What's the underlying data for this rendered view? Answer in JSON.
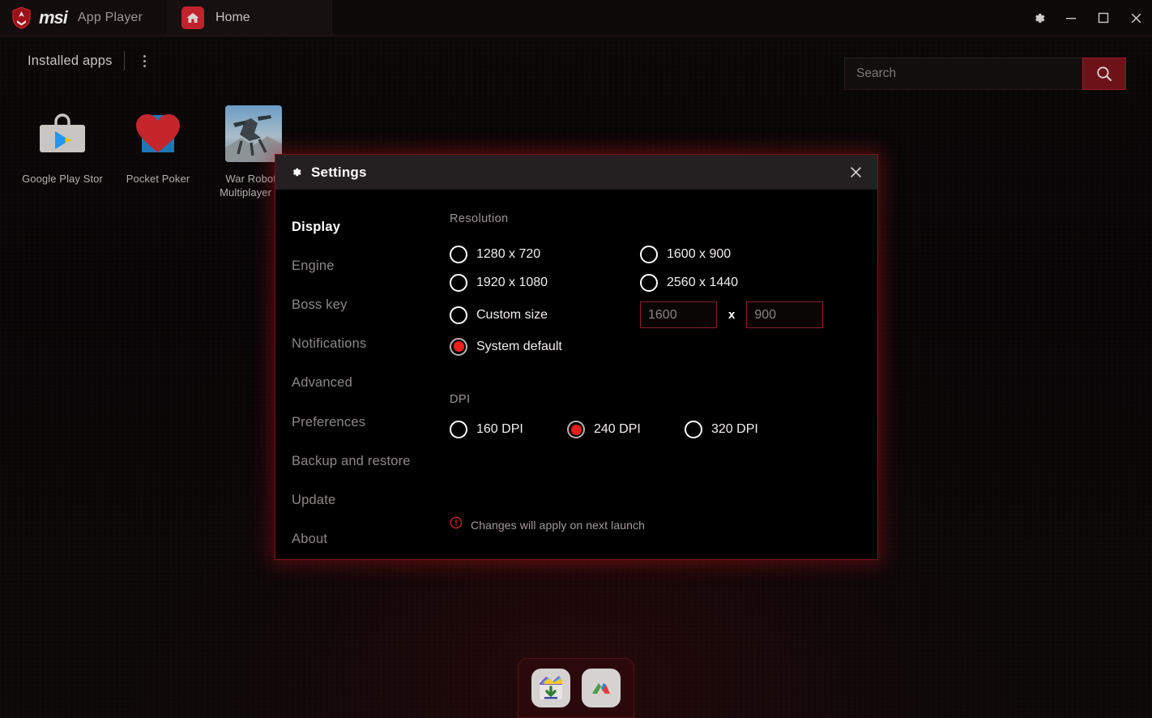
{
  "titlebar": {
    "brand_word": "msi",
    "brand_suffix": "App Player",
    "tab_label": "Home",
    "tab_icon": "home-icon",
    "settings_icon": "gear-icon",
    "minimize_icon": "minimize-icon",
    "maximize_icon": "maximize-icon",
    "close_icon": "close-icon"
  },
  "content": {
    "installed_label": "Installed apps",
    "kebab_icon": "more-options-icon"
  },
  "search": {
    "value": "",
    "placeholder": "Search",
    "icon": "search-icon"
  },
  "apps": [
    {
      "name": "Google Play Stor",
      "icon": "google-play-icon"
    },
    {
      "name": "Pocket Poker",
      "icon": "pocket-poker-icon"
    },
    {
      "name": "War Robots Multiplayer Ba",
      "icon": "war-robots-icon"
    }
  ],
  "dock": {
    "items": [
      {
        "icon": "media-gallery-icon"
      },
      {
        "icon": "app-center-icon"
      }
    ]
  },
  "dialog": {
    "title": "Settings",
    "gear_icon": "gear-icon",
    "close_icon": "close-icon",
    "nav": [
      {
        "label": "Display",
        "active": true
      },
      {
        "label": "Engine",
        "active": false
      },
      {
        "label": "Boss key",
        "active": false
      },
      {
        "label": "Notifications",
        "active": false
      },
      {
        "label": "Advanced",
        "active": false
      },
      {
        "label": "Preferences",
        "active": false
      },
      {
        "label": "Backup and restore",
        "active": false
      },
      {
        "label": "Update",
        "active": false
      },
      {
        "label": "About",
        "active": false
      }
    ],
    "resolution": {
      "section_label": "Resolution",
      "options": [
        {
          "label": "1280 x 720",
          "checked": false
        },
        {
          "label": "1600 x 900",
          "checked": false
        },
        {
          "label": "1920 x 1080",
          "checked": false
        },
        {
          "label": "2560 x 1440",
          "checked": false
        },
        {
          "label": "Custom size",
          "checked": false
        },
        {
          "label": "System default",
          "checked": true
        }
      ],
      "custom_width": {
        "value": "",
        "placeholder": "1600"
      },
      "custom_height": {
        "value": "",
        "placeholder": "900"
      },
      "x_separator": "x"
    },
    "dpi": {
      "section_label": "DPI",
      "options": [
        {
          "label": "160 DPI",
          "checked": false
        },
        {
          "label": "240 DPI",
          "checked": true
        },
        {
          "label": "320 DPI",
          "checked": false
        }
      ]
    },
    "notice": {
      "icon": "warning-icon",
      "text": "Changes will apply on next launch"
    }
  },
  "colors": {
    "accent_red": "#b9151f",
    "radio_red": "#f01d1d",
    "dialog_border": "#7d1219",
    "header_bg": "#241f20"
  }
}
